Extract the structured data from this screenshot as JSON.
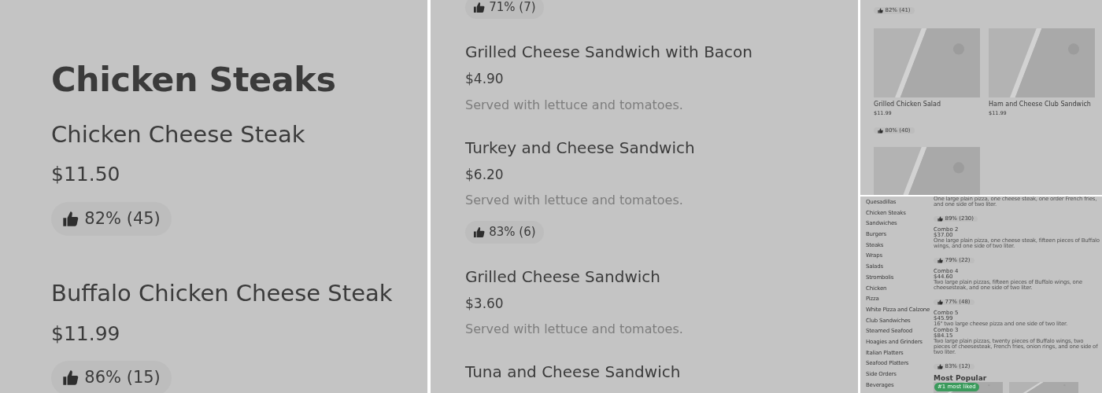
{
  "panels": [
    {
      "kind": "section",
      "heading": "Chicken Steaks",
      "items": [
        {
          "name": "Chicken Cheese Steak",
          "price": "$11.50",
          "rating": "82% (45)"
        },
        {
          "name": "Buffalo Chicken Cheese Steak",
          "price": "$11.99",
          "rating": "86% (15)"
        }
      ]
    },
    {
      "kind": "list",
      "top_rating": "71% (7)",
      "items": [
        {
          "name": "Grilled Cheese Sandwich with Bacon",
          "price": "$4.90",
          "description": "Served with lettuce and tomatoes."
        },
        {
          "name": "Turkey and Cheese Sandwich",
          "price": "$6.20",
          "description": "Served with lettuce and tomatoes.",
          "rating": "83% (6)"
        },
        {
          "name": "Grilled Cheese Sandwich",
          "price": "$3.60",
          "description": "Served with lettuce and tomatoes."
        },
        {
          "name": "Tuna and Cheese Sandwich"
        }
      ]
    },
    {
      "kind": "grid",
      "top_rating": "82% (41)",
      "cards": [
        {
          "kind": "item",
          "name": "Grilled Chicken Salad",
          "price": "$11.99",
          "rating": "80% (40)"
        },
        {
          "kind": "item",
          "name": "Ham and Cheese Club Sandwich",
          "price": "$11.99"
        },
        {
          "kind": "picture"
        }
      ]
    },
    {
      "kind": "menu",
      "categories": [
        "Quesadillas",
        "Chicken Steaks",
        "Sandwiches",
        "Burgers",
        "Steaks",
        "Wraps",
        "Salads",
        "Strombolis",
        "Chicken",
        "Pizza",
        "White Pizza and Calzone",
        "Club Sandwiches",
        "Steamed Seafood",
        "Hoagies and Grinders",
        "Italian Platters",
        "Seafood Platters",
        "Side Orders",
        "Beverages"
      ],
      "items": [
        {
          "description": "One large plain pizza, one cheese steak, one order French fries, and one side of two liter.",
          "rating": "89% (230)"
        },
        {
          "name": "Combo 2",
          "price": "$37.00",
          "description": "One large plain pizza, one cheese steak, fifteen pieces of Buffalo wings, and one side of two liter.",
          "rating": "79% (22)"
        },
        {
          "name": "Combo 4",
          "price": "$44.60",
          "description": "Two large plain pizzas, fifteen pieces of Buffalo wings, one cheesesteak, and one side of two liter.",
          "rating": "77% (48)"
        },
        {
          "name": "Combo 5",
          "price": "$45.99",
          "description": "16\" two large cheese pizza and one side of two liter."
        },
        {
          "name": "Combo 3",
          "price": "$84.15",
          "description": "Two large plain pizzas, twenty pieces of Buffalo wings, two pieces of cheesesteak, French fries, onion rings, and one side of two liter.",
          "rating": "83% (12)"
        }
      ],
      "popular": {
        "title": "Most Popular",
        "cards": [
          {
            "badge": "#1 most liked"
          },
          {
            "kind": "picture"
          }
        ]
      }
    }
  ]
}
